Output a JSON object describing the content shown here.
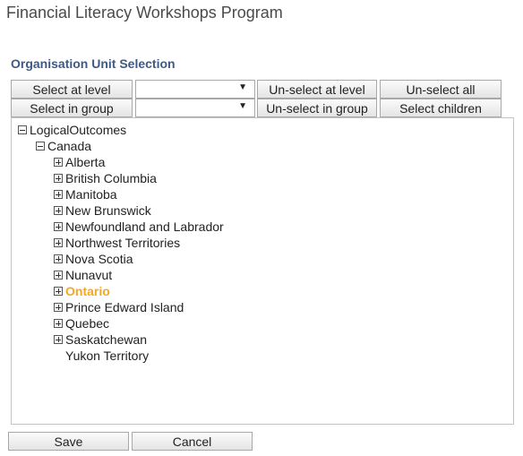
{
  "header": {
    "title": "Financial Literacy Workshops Program"
  },
  "section": {
    "title": "Organisation Unit Selection"
  },
  "toolbar": {
    "select_at_level": "Select at level",
    "level_value": "",
    "unselect_at_level": "Un-select at level",
    "unselect_all": "Un-select all",
    "select_in_group": "Select in group",
    "group_value": "",
    "unselect_in_group": "Un-select in group",
    "select_children": "Select children"
  },
  "tree": {
    "root": {
      "label": "LogicalOutcomes",
      "toggle": "minus-icon"
    },
    "country": {
      "label": "Canada",
      "toggle": "minus-icon"
    },
    "provinces": [
      {
        "label": "Alberta",
        "toggle": "plus-icon",
        "selected": false
      },
      {
        "label": "British Columbia",
        "toggle": "plus-icon",
        "selected": false
      },
      {
        "label": "Manitoba",
        "toggle": "plus-icon",
        "selected": false
      },
      {
        "label": "New Brunswick",
        "toggle": "plus-icon",
        "selected": false
      },
      {
        "label": "Newfoundland and Labrador",
        "toggle": "plus-icon",
        "selected": false
      },
      {
        "label": "Northwest Territories",
        "toggle": "plus-icon",
        "selected": false
      },
      {
        "label": "Nova Scotia",
        "toggle": "plus-icon",
        "selected": false
      },
      {
        "label": "Nunavut",
        "toggle": "plus-icon",
        "selected": false
      },
      {
        "label": "Ontario",
        "toggle": "plus-icon",
        "selected": true
      },
      {
        "label": "Prince Edward Island",
        "toggle": "plus-icon",
        "selected": false
      },
      {
        "label": "Quebec",
        "toggle": "plus-icon",
        "selected": false
      },
      {
        "label": "Saskatchewan",
        "toggle": "plus-icon",
        "selected": false
      },
      {
        "label": "Yukon Territory",
        "toggle": "",
        "selected": false
      }
    ],
    "selected_color": "#f5a623"
  },
  "footer": {
    "save": "Save",
    "cancel": "Cancel"
  }
}
